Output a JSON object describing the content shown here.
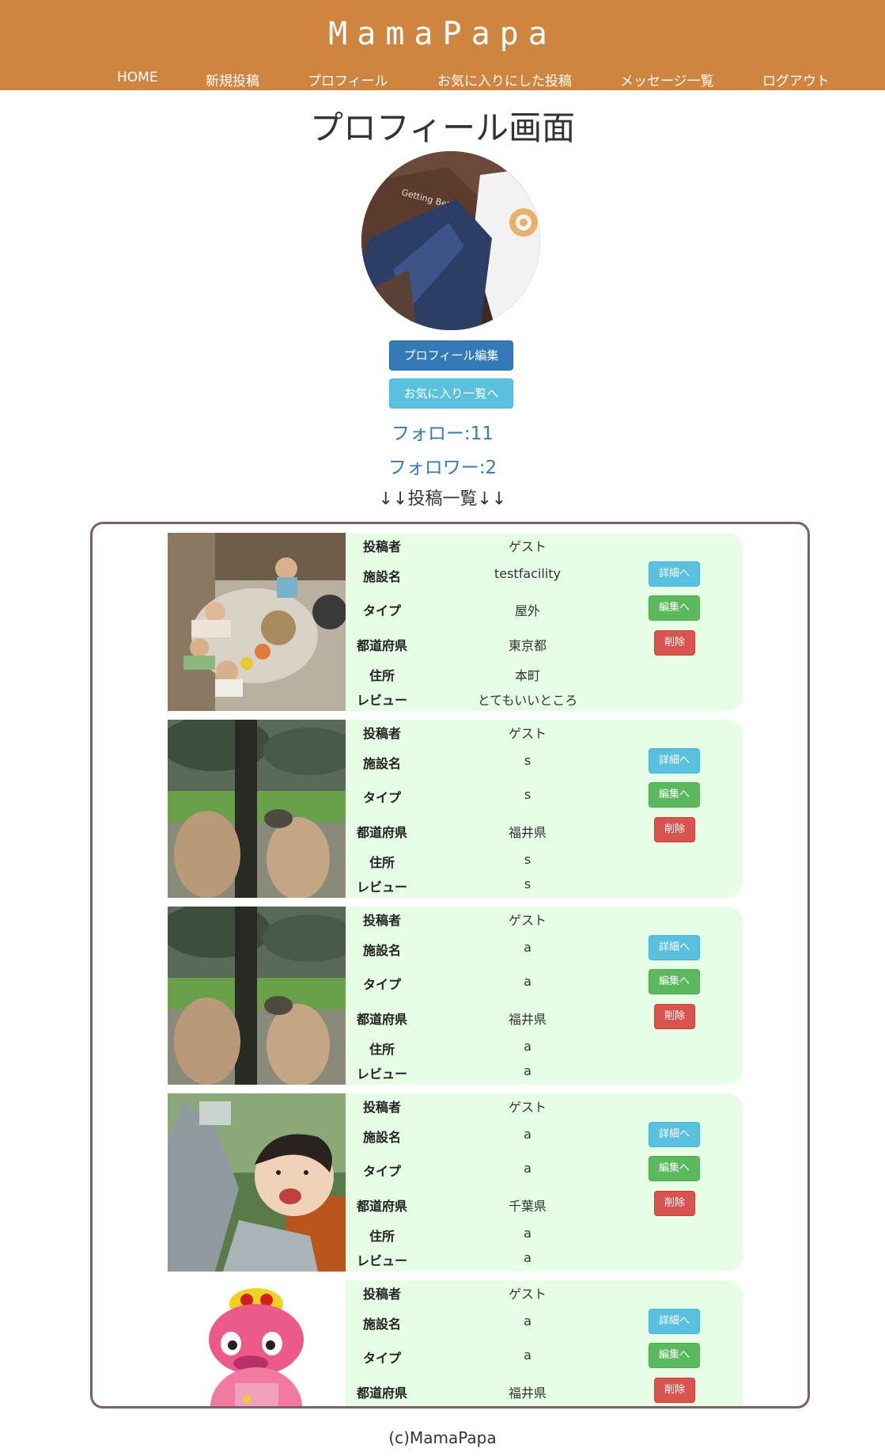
{
  "brand": "MamaPapa",
  "nav": [
    {
      "label": "HOME"
    },
    {
      "label": "新規投稿"
    },
    {
      "label": "プロフィール"
    },
    {
      "label": "お気に入りにした投稿"
    },
    {
      "label": "メッセージ一覧"
    },
    {
      "label": "ログアウト"
    }
  ],
  "page_title": "プロフィール画面",
  "buttons": {
    "edit_profile": "プロフィール編集",
    "favorites_list": "お気に入り一覧へ"
  },
  "follow_count": "フォロー:11",
  "follower_count": "フォロワー:2",
  "posts_heading": "↓↓投稿一覧↓↓",
  "labels": {
    "poster": "投稿者",
    "facility": "施設名",
    "type": "タイプ",
    "prefecture": "都道府県",
    "address": "住所",
    "review": "レビュー"
  },
  "actions": {
    "detail": "詳細へ",
    "edit": "編集へ",
    "delete": "削除"
  },
  "posts": [
    {
      "poster": "ゲスト",
      "facility": "testfacility",
      "type": "屋外",
      "prefecture": "東京都",
      "address": "本町",
      "review": "とてもいいところ",
      "photo": "babies-playroom"
    },
    {
      "poster": "ゲスト",
      "facility": "s",
      "type": "s",
      "prefecture": "福井県",
      "address": "s",
      "review": "s",
      "photo": "park-rocks"
    },
    {
      "poster": "ゲスト",
      "facility": "a",
      "type": "a",
      "prefecture": "福井県",
      "address": "a",
      "review": "a",
      "photo": "park-rocks"
    },
    {
      "poster": "ゲスト",
      "facility": "a",
      "type": "a",
      "prefecture": "千葉県",
      "address": "a",
      "review": "a",
      "photo": "baby-smiling"
    },
    {
      "poster": "ゲスト",
      "facility": "a",
      "type": "a",
      "prefecture": "福井県",
      "address": "",
      "review": "",
      "photo": "pink-mascot"
    }
  ],
  "footer": "(c)MamaPapa"
}
